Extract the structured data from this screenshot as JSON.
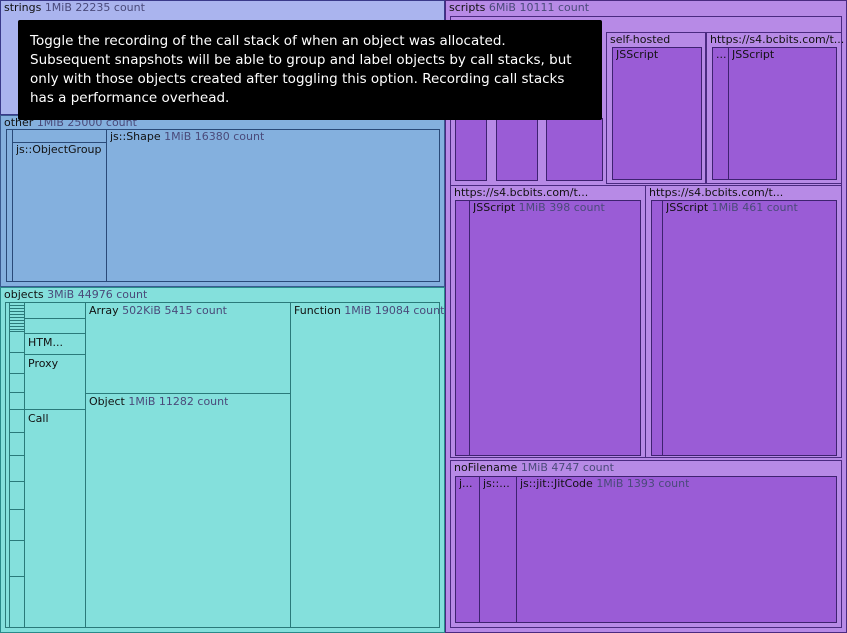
{
  "tooltip": {
    "text": "Toggle the recording of the call stack of when an object was allocated. Subsequent snapshots will be able to group and label objects by call stacks, but only with those objects created after toggling this option. Recording call stacks has a performance overhead."
  },
  "strings": {
    "name": "strings",
    "meta": "1MiB 22235 count"
  },
  "other": {
    "name": "other",
    "meta": "1MiB 25000 count",
    "children": [
      {
        "name": "js::ObjectGroup",
        "meta": ""
      },
      {
        "name": "js::Shape",
        "meta": "1MiB 16380 count"
      }
    ]
  },
  "objects": {
    "name": "objects",
    "meta": "3MiB 44976 count",
    "children": [
      {
        "name": "HTM...",
        "meta": ""
      },
      {
        "name": "Proxy",
        "meta": ""
      },
      {
        "name": "Call",
        "meta": ""
      },
      {
        "name": "Array",
        "meta": "502KiB 5415 count"
      },
      {
        "name": "Object",
        "meta": "1MiB 11282 count"
      },
      {
        "name": "Function",
        "meta": "1MiB 19084 count"
      }
    ]
  },
  "scripts": {
    "name": "scripts",
    "meta": "6MiB 10111 count",
    "groups": [
      {
        "name": "self-hosted",
        "child": "JSScript"
      },
      {
        "name": "https://s4.bcbits.com/t...",
        "child": "JSScript",
        "extra": "..."
      },
      {
        "name": "https://s4.bcbits.com/t...",
        "child": "JSScript",
        "child_meta": "1MiB 398 count"
      },
      {
        "name": "https://s4.bcbits.com/t...",
        "child": "JSScript",
        "child_meta": "1MiB 461 count"
      }
    ],
    "noFilename": {
      "name": "noFilename",
      "meta": "1MiB 4747 count",
      "children": [
        {
          "name": "j..."
        },
        {
          "name": "js::..."
        },
        {
          "name": "js::jit::JitCode",
          "meta": "1MiB 1393 count"
        }
      ]
    }
  },
  "colors": {
    "strings": "#aab4ee",
    "other": "#84b0de",
    "objects": "#84e0dc",
    "scripts": "#b78ae6",
    "script_leaf": "#9a5cd6"
  }
}
